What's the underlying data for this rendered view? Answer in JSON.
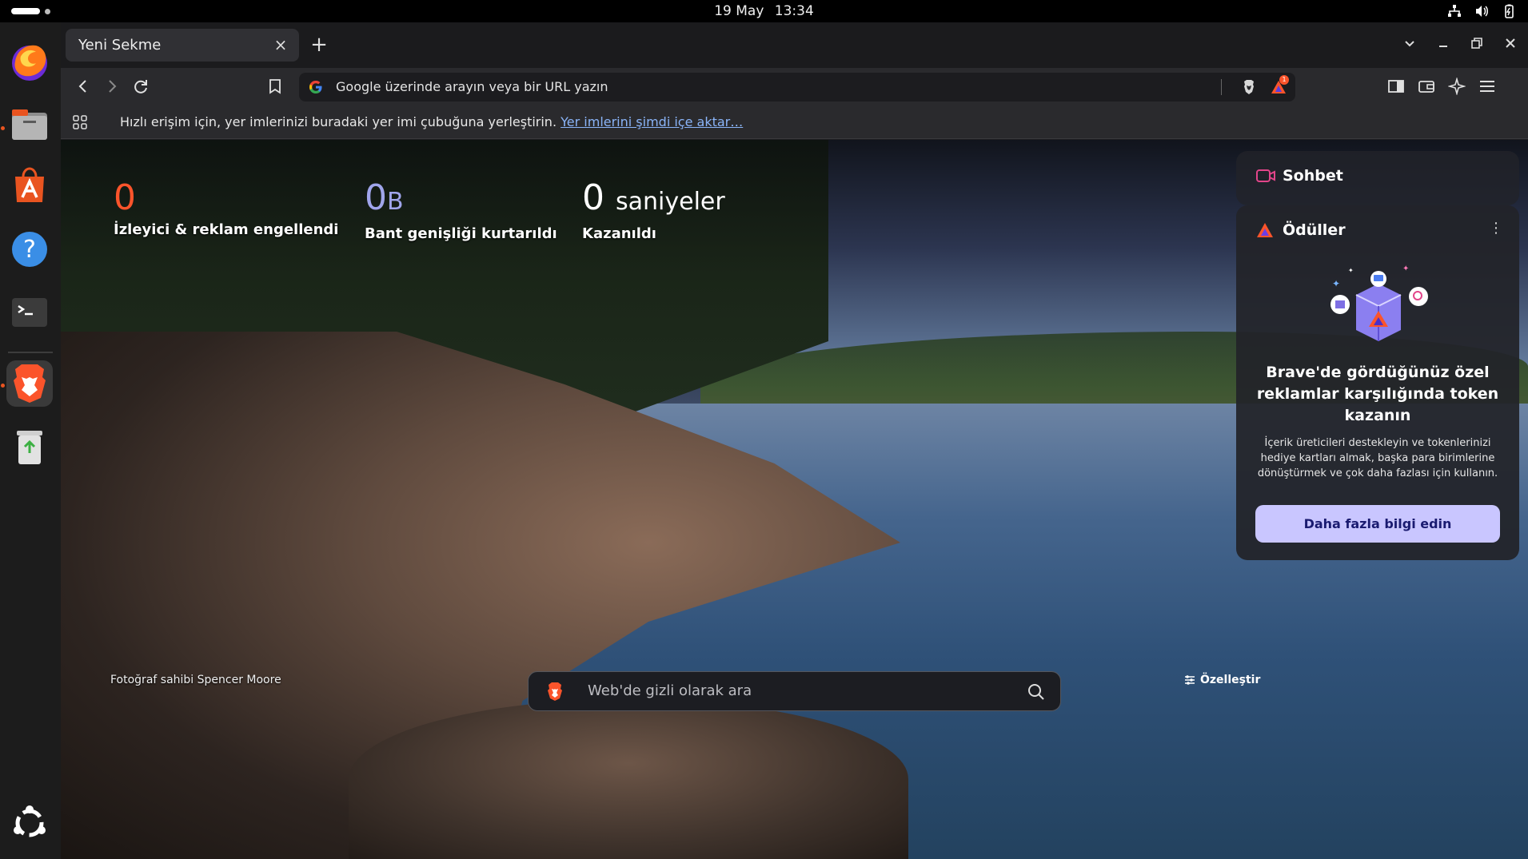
{
  "system": {
    "date": "19 May",
    "time": "13:34"
  },
  "dock": {
    "apps": [
      {
        "name": "Firefox",
        "icon": "firefox-icon"
      },
      {
        "name": "Files",
        "icon": "files-icon"
      },
      {
        "name": "App Center",
        "icon": "app-center-icon"
      },
      {
        "name": "Help",
        "icon": "help-icon"
      },
      {
        "name": "Terminal",
        "icon": "terminal-icon"
      },
      {
        "name": "Brave",
        "icon": "brave-icon"
      },
      {
        "name": "Trash",
        "icon": "trash-icon"
      }
    ],
    "show_apps_icon": "ubuntu-icon"
  },
  "browser": {
    "tab": {
      "title": "Yeni Sekme"
    },
    "omnibox": {
      "placeholder": "Google üzerinde arayın veya bir URL yazın",
      "rewards_badge": "1"
    },
    "bookmarks_bar": {
      "hint": "Hızlı erişim için, yer imlerinizi buradaki yer imi çubuğuna yerleştirin.",
      "import_link": "Yer imlerini şimdi içe aktar…"
    }
  },
  "ntp": {
    "stats": [
      {
        "value": "0",
        "unit": "",
        "label": "İzleyici & reklam engellendi",
        "color": "#fb542b"
      },
      {
        "value": "0",
        "unit": "B",
        "label": "Bant genişliği kurtarıldı",
        "color": "#a0a5eb"
      },
      {
        "value": "0",
        "unit": "saniyeler",
        "label": "Kazanıldı",
        "color": "#ffffff"
      }
    ],
    "photo_credit": "Fotoğraf sahibi Spencer Moore",
    "customize_label": "Özelleştir",
    "search": {
      "placeholder": "Web'de gizli olarak ara"
    },
    "chat_card": {
      "title": "Sohbet"
    },
    "rewards_card": {
      "title": "Ödüller",
      "heading": "Brave'de gördüğünüz özel reklamlar karşılığında token kazanın",
      "body": "İçerik üreticileri destekleyin ve tokenlerinizi hediye kartları almak, başka para birimlerine dönüştürmek ve çok daha fazlası için kullanın.",
      "button": "Daha fazla bilgi edin"
    }
  },
  "colors": {
    "brave_orange": "#fb542b",
    "link": "#8ab4f8",
    "rewards_button": "#c9c6ff"
  }
}
